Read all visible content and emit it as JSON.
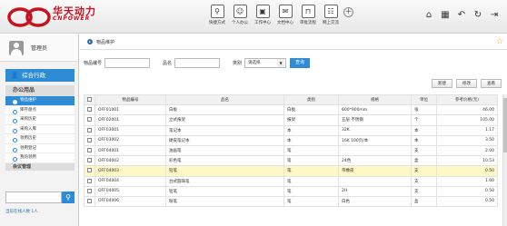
{
  "brand": {
    "cn": "华天动力",
    "en": "CNPOWER"
  },
  "nav": [
    {
      "icon": "shortcut-icon",
      "glyph": "⚲",
      "label": "快捷方式"
    },
    {
      "icon": "person-icon",
      "glyph": "☺",
      "label": "个人办公"
    },
    {
      "icon": "work-icon",
      "glyph": "▣",
      "label": "工作中心"
    },
    {
      "icon": "doc-icon",
      "glyph": "✉",
      "label": "文档中心"
    },
    {
      "icon": "flow-icon",
      "glyph": "⊓",
      "label": "审批流程"
    },
    {
      "icon": "chat-icon",
      "glyph": "☷",
      "label": "网上交流"
    }
  ],
  "top_right": [
    "home-icon",
    "grid-icon",
    "back-icon",
    "refresh-icon",
    "exit-icon"
  ],
  "user": {
    "name": "管理员"
  },
  "module": {
    "label": "综合行政"
  },
  "group": {
    "label": "办公用品"
  },
  "menu": [
    "物品维护",
    "库存盘点",
    "采购历史",
    "采购入库",
    "领用历史",
    "领用登记",
    "我的领用"
  ],
  "group2": "会议管理",
  "online": "当前在线人数 1人",
  "breadcrumb": "物品维护",
  "filter": {
    "code_label": "物品编号",
    "name_label": "品名",
    "type_label": "类别",
    "type_value": "请选择",
    "query": "查询"
  },
  "tools": [
    "新建",
    "修改",
    "查看"
  ],
  "table": {
    "headers": [
      "物品编号",
      "品名",
      "类别",
      "规格",
      "单位",
      "参考价格(元)"
    ],
    "rows": [
      [
        "OFF01001",
        "白板",
        "白板",
        "600*900mm",
        "张",
        "46.00"
      ],
      [
        "OFF02001",
        "立式报架",
        "报架",
        "五层 不锈钢",
        "个",
        "105.00"
      ],
      [
        "OFF03001",
        "笔记本",
        "本",
        "32K",
        "本",
        "1.17"
      ],
      [
        "OFF03002",
        "硬皮笔记本",
        "本",
        "16K 100页/本",
        "本",
        "3.50"
      ],
      [
        "OFF04001",
        "油画笔",
        "笔",
        "",
        "支",
        "2.00"
      ],
      [
        "OFF04002",
        "彩色笔",
        "笔",
        "24色",
        "盒",
        "10.53"
      ],
      [
        "OFF04003",
        "铅笔",
        "笔",
        "带橡皮",
        "支",
        "0.50"
      ],
      [
        "OFF04004",
        "台式圆珠笔",
        "笔",
        "",
        "支",
        "1.60"
      ],
      [
        "OFF04005",
        "铅笔",
        "笔",
        "2H",
        "支",
        "0.50"
      ],
      [
        "OFF04006",
        "粉笔",
        "笔",
        "白色",
        "盒",
        "0.50"
      ]
    ]
  },
  "highlight_row": 6
}
